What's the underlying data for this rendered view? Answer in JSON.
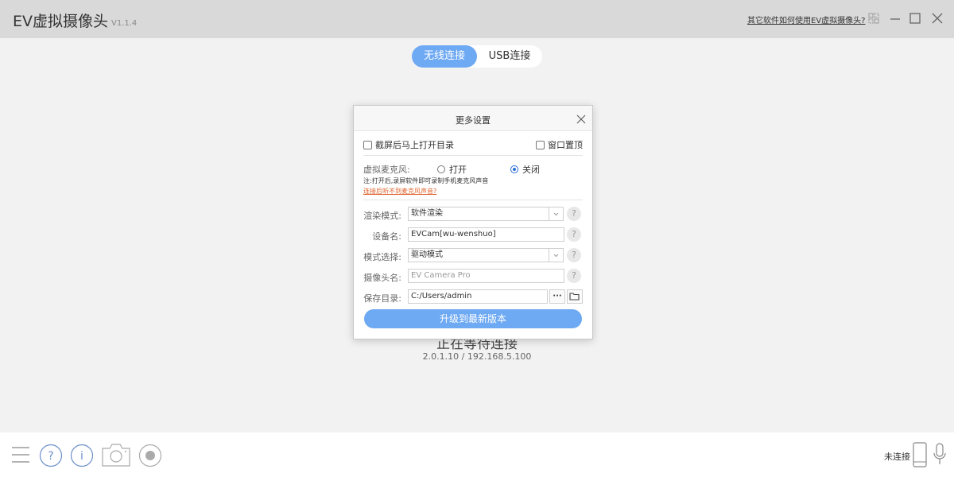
{
  "app": {
    "title": "EV虚拟摄像头",
    "version": "V1.1.4",
    "help_link": "其它软件如何使用EV虚拟摄像头?"
  },
  "tabs": [
    {
      "label": "无线连接",
      "active": true
    },
    {
      "label": "USB连接",
      "active": false
    }
  ],
  "status": {
    "main": "正在等待连接",
    "sub": "2.0.1.10 / 192.168.5.100"
  },
  "bottom": {
    "connection_status": "未连接",
    "icons": [
      "menu-icon",
      "help-icon",
      "info-icon",
      "camera-icon",
      "record-icon",
      "phone-icon",
      "microphone-icon"
    ]
  },
  "modal": {
    "title": "更多设置",
    "checkbox_open_dir": "截屏后马上打开目录",
    "checkbox_on_top": "窗口置顶",
    "mic_label": "虚拟麦克风:",
    "mic_on": "打开",
    "mic_off": "关闭",
    "mic_selected": "关闭",
    "note": "注:打开后,录屏软件即可录制手机麦克风声音",
    "note_link": "连接后听不到麦克风声音?",
    "render_label": "渲染模式:",
    "render_value": "软件渲染",
    "device_label": "设备名:",
    "device_value": "EVCam[wu-wenshuo]",
    "mode_label": "模式选择:",
    "mode_value": "驱动模式",
    "camera_label": "摄像头名:",
    "camera_placeholder": "EV Camera Pro",
    "save_label": "保存目录:",
    "save_value": "C:/Users/admin",
    "browse_label": "···",
    "upgrade_label": "升级到最新版本"
  },
  "colors": {
    "accent": "#6ea9f3",
    "titlebar": "#d9d9d9",
    "link_orange": "#e0612a",
    "radio_blue": "#2b6fd6"
  }
}
